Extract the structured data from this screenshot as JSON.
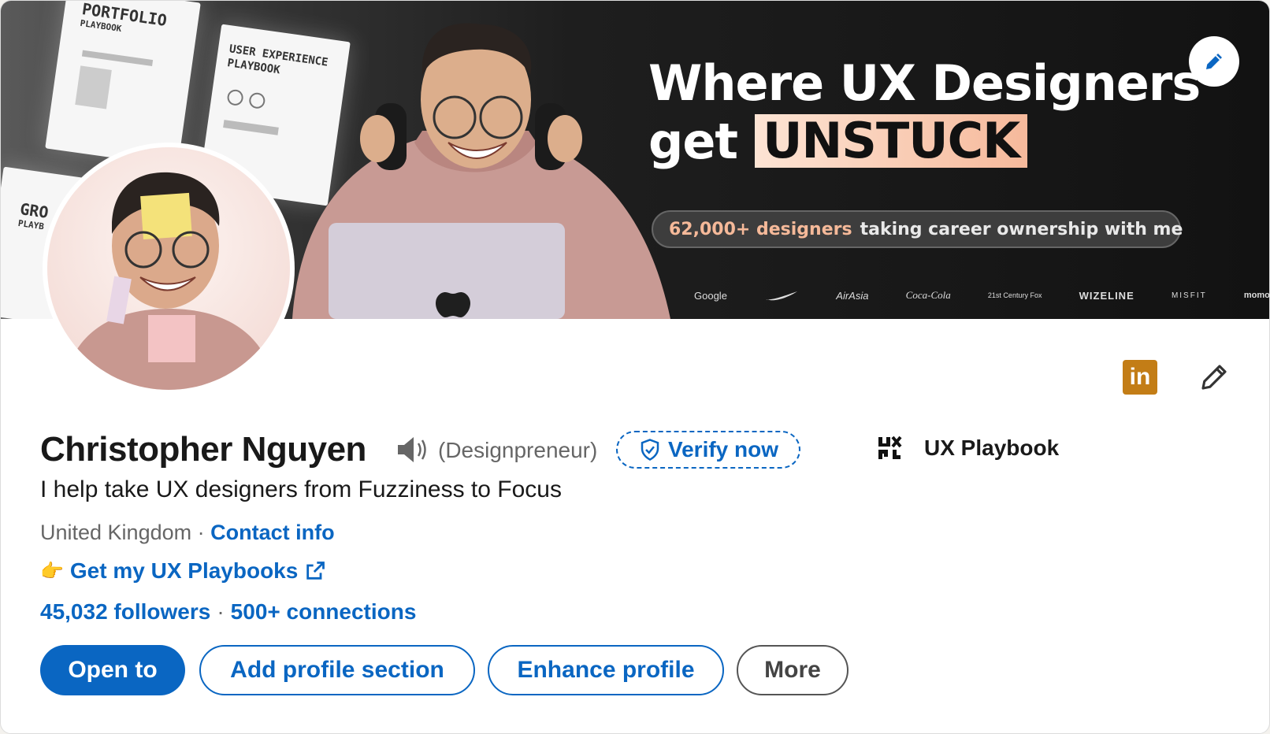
{
  "banner": {
    "docs": [
      {
        "title": "PORTFOLIO",
        "subtitle": "PLAYBOOK"
      },
      {
        "title": "USER EXPERIENCE",
        "subtitle": "PLAYBOOK"
      },
      {
        "title": "GRO",
        "subtitle": "PLAYB"
      }
    ],
    "headline_line1": "Where UX Designers",
    "headline_get": "get",
    "headline_highlight": "UNSTUCK",
    "pill_highlight": "62,000+ designers",
    "pill_rest": "taking career ownership with me",
    "logos": [
      "Google",
      "Nike",
      "AirAsia",
      "Coca-Cola",
      "21st Century Fox",
      "WIZELINE",
      "MISFIT",
      "momo"
    ]
  },
  "profile": {
    "name": "Christopher Nguyen",
    "pronoun": "(Designpreneur)",
    "verify_label": "Verify now",
    "headline": "I help take UX designers from Fuzziness to Focus",
    "location": "United Kingdom",
    "separator": " · ",
    "contact_label": "Contact info",
    "link_emoji": "👉",
    "link_label": "Get my UX Playbooks",
    "followers": "45,032 followers",
    "connections": "500+ connections",
    "stat_separator": "·"
  },
  "company": {
    "name": "UX Playbook",
    "logo_text": "UX PL"
  },
  "actions": {
    "open_to": "Open to",
    "add_section": "Add profile section",
    "enhance": "Enhance profile",
    "more": "More"
  },
  "colors": {
    "primary": "#0a66c2",
    "linkedin_badge": "#c37d16",
    "highlight": "#f5b999"
  }
}
